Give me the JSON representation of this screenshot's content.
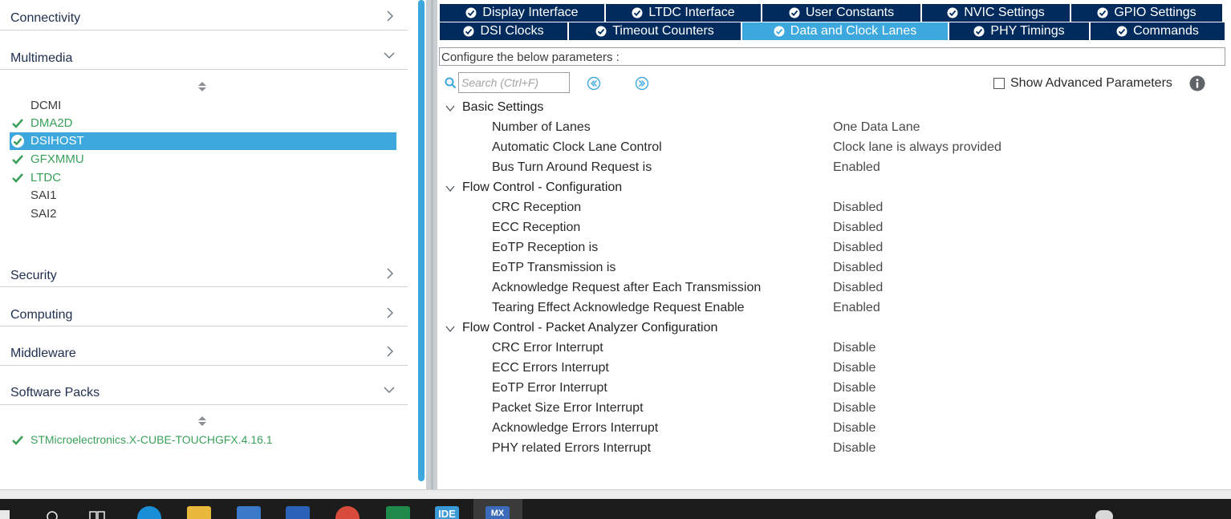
{
  "left_panel": {
    "categories": [
      {
        "label": "Connectivity",
        "expanded": false
      },
      {
        "label": "Multimedia",
        "expanded": true
      },
      {
        "label": "Security",
        "expanded": false
      },
      {
        "label": "Computing",
        "expanded": false
      },
      {
        "label": "Middleware",
        "expanded": false
      },
      {
        "label": "Software Packs",
        "expanded": true
      }
    ],
    "multimedia_items": [
      {
        "label": "DCMI",
        "status": "none"
      },
      {
        "label": "DMA2D",
        "status": "enabled"
      },
      {
        "label": "DSIHOST",
        "status": "selected"
      },
      {
        "label": "GFXMMU",
        "status": "enabled"
      },
      {
        "label": "LTDC",
        "status": "enabled"
      },
      {
        "label": "SAI1",
        "status": "none"
      },
      {
        "label": "SAI2",
        "status": "none"
      }
    ],
    "software_pack_items": [
      {
        "label": "STMicroelectronics.X-CUBE-TOUCHGFX.4.16.1",
        "status": "enabled"
      }
    ]
  },
  "tabs": {
    "row1": [
      "Display Interface",
      "LTDC Interface",
      "User Constants",
      "NVIC Settings",
      "GPIO Settings"
    ],
    "row2": [
      "DSI Clocks",
      "Timeout Counters",
      "Data and Clock Lanes",
      "PHY Timings",
      "Commands"
    ],
    "active": "Data and Clock Lanes"
  },
  "config": {
    "header": "Configure the below parameters :",
    "search_placeholder": "Search (Ctrl+F)",
    "show_advanced_label": "Show Advanced Parameters",
    "show_advanced_checked": false
  },
  "groups": [
    {
      "title": "Basic Settings",
      "params": [
        {
          "name": "Number of Lanes",
          "value": "One Data Lane"
        },
        {
          "name": "Automatic Clock Lane Control",
          "value": "Clock lane is always provided"
        },
        {
          "name": "Bus Turn Around Request is",
          "value": "Enabled"
        }
      ]
    },
    {
      "title": "Flow Control - Configuration",
      "params": [
        {
          "name": "CRC Reception",
          "value": "Disabled"
        },
        {
          "name": "ECC Reception",
          "value": "Disabled"
        },
        {
          "name": "EoTP Reception is",
          "value": "Disabled"
        },
        {
          "name": "EoTP Transmission is",
          "value": "Disabled"
        },
        {
          "name": "Acknowledge Request after Each Transmission",
          "value": "Disabled"
        },
        {
          "name": "Tearing Effect Acknowledge Request Enable",
          "value": "Enabled"
        }
      ]
    },
    {
      "title": "Flow Control - Packet Analyzer Configuration",
      "params": [
        {
          "name": "CRC Error Interrupt",
          "value": "Disable"
        },
        {
          "name": "ECC Errors Interrupt",
          "value": "Disable"
        },
        {
          "name": "EoTP Error Interrupt",
          "value": "Disable"
        },
        {
          "name": "Packet Size Error Interrupt",
          "value": "Disable"
        },
        {
          "name": "Acknowledge Errors Interrupt",
          "value": "Disable"
        },
        {
          "name": "PHY related Errors Interrupt",
          "value": "Disable"
        }
      ]
    }
  ],
  "taskbar": {
    "apps": [
      "start-icon",
      "search-icon",
      "task-view-icon",
      "edge-icon",
      "file-explorer-icon",
      "store-icon",
      "mail-icon",
      "chrome-icon",
      "excel-icon",
      "ide-icon",
      "cubemx-icon"
    ],
    "ide_label": "IDE",
    "mx_label": "MX"
  },
  "colors": {
    "tab_dark": "#002b5c",
    "tab_active": "#3ca8dd",
    "enabled_green": "#3aa05a",
    "selection_blue": "#3ca8dd"
  }
}
